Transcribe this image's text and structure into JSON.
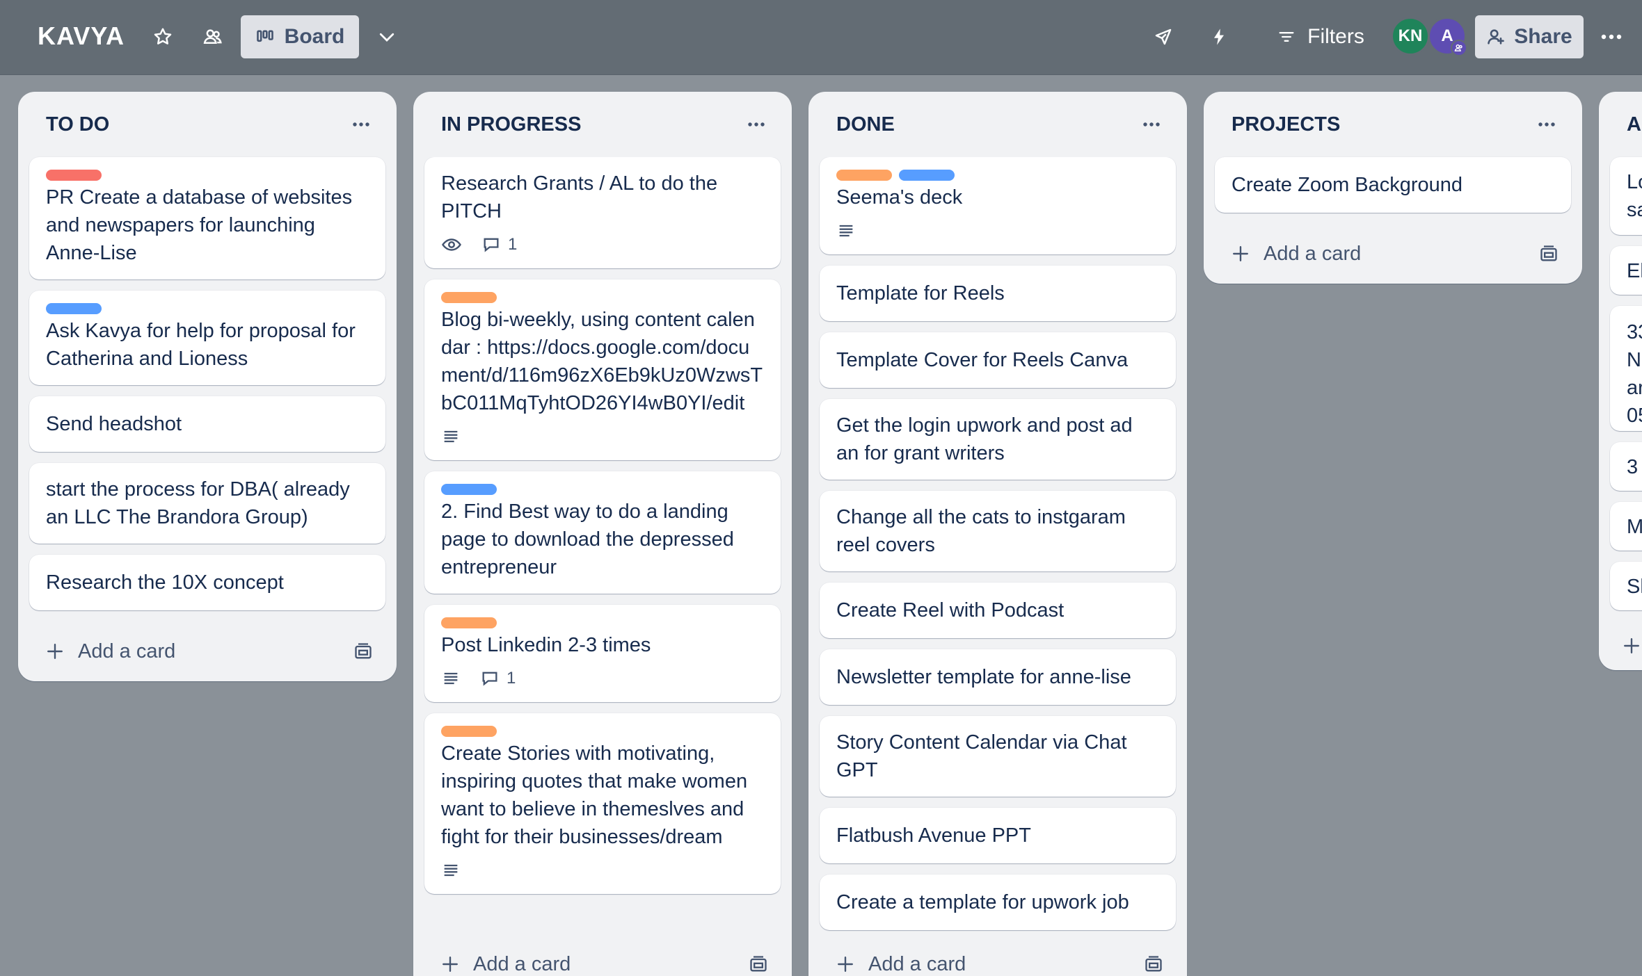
{
  "header": {
    "board_name": "KAVYA",
    "view_label": "Board",
    "filters_label": "Filters",
    "share_label": "Share",
    "avatars": [
      {
        "initials": "KN",
        "color": "#1f845a"
      },
      {
        "initials": "A",
        "color": "#5e4db2"
      }
    ],
    "icons": [
      "star-icon",
      "workspace-visible-icon",
      "board-icon",
      "chevron-down-icon",
      "rocket-icon",
      "bolt-icon",
      "filter-icon",
      "add-member-icon",
      "more-icon"
    ]
  },
  "colors": {
    "label_red": "#f87168",
    "label_blue": "#579dff",
    "label_orange": "#fea362"
  },
  "add_card_label": "Add a card",
  "lists": {
    "todo": {
      "title": "TO DO",
      "cards": [
        {
          "title": "PR Create a database of websites and newspapers for launching Anne-Lise",
          "labels": [
            "red"
          ]
        },
        {
          "title": "Ask Kavya for help for proposal for Catherina and Lioness",
          "labels": [
            "blue"
          ]
        },
        {
          "title": "Send headshot"
        },
        {
          "title": "start the process for DBA( already an LLC The Brandora Group)"
        },
        {
          "title": "Research the 10X concept"
        }
      ]
    },
    "inprogress": {
      "title": "IN PROGRESS",
      "cards": [
        {
          "title": "Research Grants / AL to do the PITCH",
          "comments": "1",
          "watching": true
        },
        {
          "title": "Blog bi-weekly, using content calendar : https://docs.google.com/document/d/116m96zX6Eb9kUz0WzwsTbC011MqTyhtOD26YI4wB0YI/edit",
          "labels": [
            "orange"
          ],
          "description": true
        },
        {
          "title": "2. Find Best way to do a landing page to download the depressed entrepreneur",
          "labels": [
            "blue"
          ]
        },
        {
          "title": "Post Linkedin 2-3 times",
          "labels": [
            "orange"
          ],
          "description": true,
          "comments": "1"
        },
        {
          "title": "Create Stories with motivating, inspiring quotes that make women want to believe in themeslves and fight for their businesses/dream",
          "labels": [
            "orange"
          ]
        }
      ]
    },
    "done": {
      "title": "DONE",
      "cards": [
        {
          "title": "Seema's deck",
          "labels": [
            "orange",
            "blue"
          ],
          "description": true
        },
        {
          "title": "Template for Reels"
        },
        {
          "title": "Template Cover for Reels Canva"
        },
        {
          "title": "Get the login upwork and post ad an for grant writers"
        },
        {
          "title": "Change all the cats to instgaram reel covers"
        },
        {
          "title": "Create Reel with Podcast"
        },
        {
          "title": "Newsletter template for anne-lise"
        },
        {
          "title": "Story Content Calendar via Chat GPT"
        },
        {
          "title": "Flatbush Avenue PPT"
        },
        {
          "title": "Create a template for upwork job"
        }
      ]
    },
    "projects": {
      "title": "PROJECTS",
      "cards": [
        {
          "title": "Create Zoom Background"
        }
      ]
    },
    "partial": {
      "title": "A",
      "cards": [
        {
          "title": "Lo sa"
        },
        {
          "title": "El"
        },
        {
          "title": "33 N ar 05"
        },
        {
          "title": "3"
        },
        {
          "title": "M"
        },
        {
          "title": "Sl"
        }
      ]
    }
  }
}
